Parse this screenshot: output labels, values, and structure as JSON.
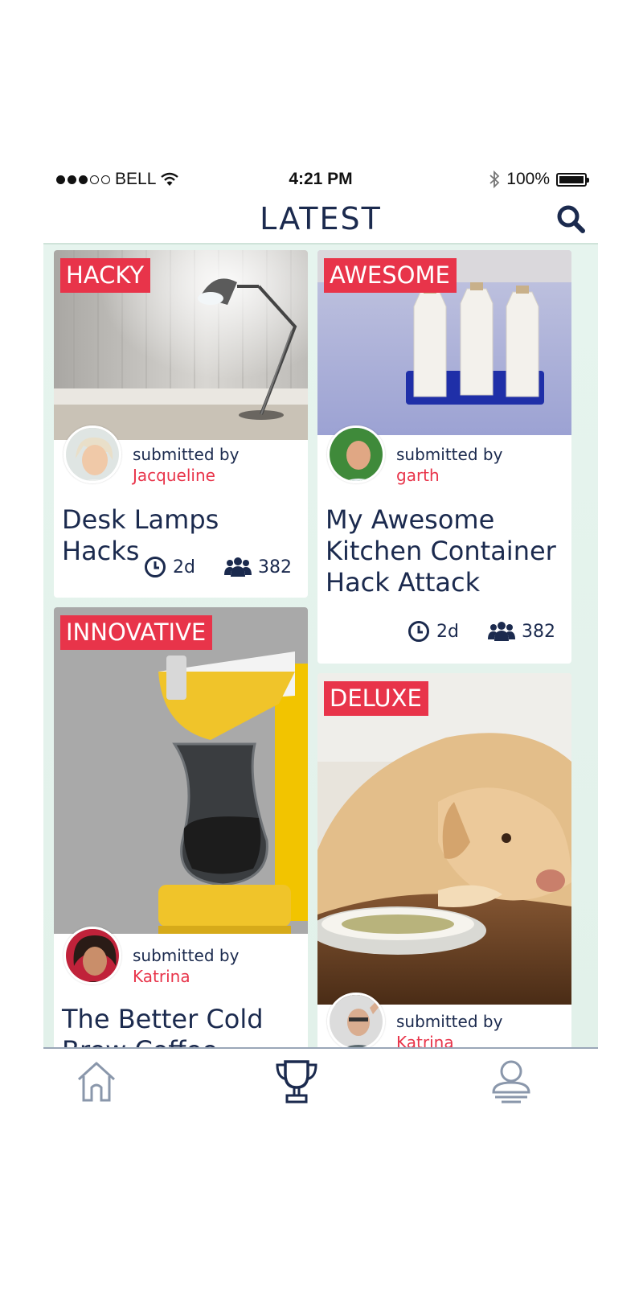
{
  "status_bar": {
    "carrier": "BELL",
    "time": "4:21 PM",
    "battery": "100%",
    "signal_dots_filled": 3,
    "signal_dots_total": 5
  },
  "header": {
    "title": "LATEST",
    "search_icon": "search-icon"
  },
  "feed": {
    "submitted_label": "submitted by",
    "cards": [
      {
        "badge": "HACKY",
        "author": "Jacqueline",
        "title": "Desk Lamps Hacks",
        "age": "2d",
        "count": "382"
      },
      {
        "badge": "AWESOME",
        "author": "garth",
        "title": "My Awesome Kitchen Container Hack Attack",
        "age": "2d",
        "count": "382"
      },
      {
        "badge": "INNOVATIVE",
        "author": "Katrina",
        "title": "The Better Cold Brew Coffee"
      },
      {
        "badge": "DELUXE",
        "author": "Katrina"
      }
    ]
  },
  "tab_bar": {
    "tabs": [
      "home-icon",
      "trophy-icon",
      "profile-icon"
    ],
    "active": "trophy-icon"
  },
  "colors": {
    "accent": "#e8344a",
    "navy": "#1b2a4e",
    "feed_bg": "#e4f2ec"
  }
}
